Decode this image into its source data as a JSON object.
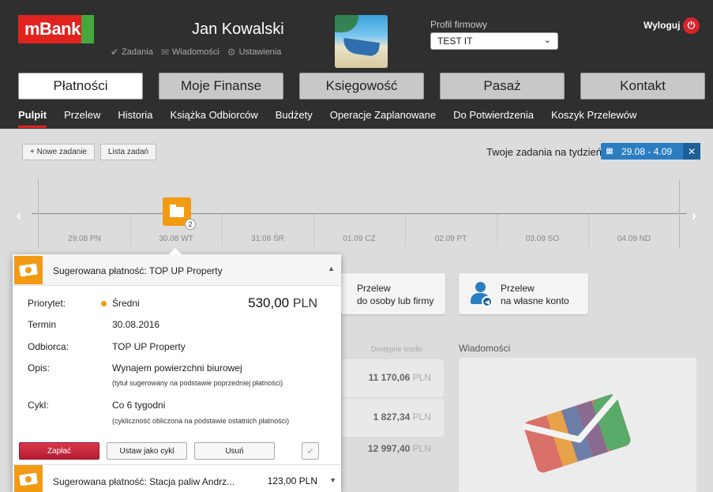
{
  "brand": {
    "logo_text": "mBank",
    "red": "#e0231f",
    "orange": "#f39a14",
    "blue": "#2b7dc2"
  },
  "user": {
    "name": "Jan Kowalski",
    "links": [
      {
        "icon": "check-icon",
        "label": "Zadania"
      },
      {
        "icon": "envelope-icon",
        "label": "Wiadomości"
      },
      {
        "icon": "gear-icon",
        "label": "Ustawienia"
      }
    ]
  },
  "profile": {
    "label": "Profil firmowy",
    "selected": "TEST IT"
  },
  "logout": {
    "label": "Wyloguj",
    "icon": "power-icon"
  },
  "main_tabs": [
    {
      "label": "Płatności",
      "active": true
    },
    {
      "label": "Moje Finanse"
    },
    {
      "label": "Księgowość"
    },
    {
      "label": "Pasaż"
    },
    {
      "label": "Kontakt"
    }
  ],
  "sub_nav": [
    {
      "label": "Pulpit",
      "active": true
    },
    {
      "label": "Przelew"
    },
    {
      "label": "Historia"
    },
    {
      "label": "Książka Odbiorców"
    },
    {
      "label": "Budżety"
    },
    {
      "label": "Operacje Zaplanowane"
    },
    {
      "label": "Do Potwierdzenia"
    },
    {
      "label": "Koszyk Przelewów"
    }
  ],
  "tasks": {
    "new_task": "+ Nowe zadanie",
    "task_list": "Lista zadań",
    "week_label": "Twoje zadania na tydzień",
    "week_range": "29.08 - 4.09",
    "days": [
      "29.08 PN",
      "30.08 WT",
      "31.08 ŚR",
      "01.09 CZ",
      "02.09 PT",
      "03.09 SO",
      "04.09 ND"
    ],
    "folder_badge": "2"
  },
  "quick_tiles": [
    {
      "line1": "Przelew",
      "line2": "do osoby lub firmy"
    },
    {
      "line1": "Przelew",
      "line2": "na własne konto"
    }
  ],
  "accounts": {
    "column_label": "Dostępne środki",
    "balances": [
      {
        "value": "11 170,06",
        "currency": "PLN"
      },
      {
        "value": "1 827,34",
        "currency": "PLN"
      },
      {
        "value": "12 997,40",
        "currency": "PLN"
      }
    ]
  },
  "news": {
    "title": "Wiadomości"
  },
  "popup": {
    "title": "Sugerowana płatność: TOP UP Property",
    "priority_label": "Priorytet:",
    "priority_value": "Średni",
    "amount": "530,00",
    "currency": "PLN",
    "term_label": "Termin",
    "term_value": "30.08.2016",
    "recipient_label": "Odbiorca:",
    "recipient_value": "TOP UP Property",
    "desc_label": "Opis:",
    "desc_value": "Wynajem powierzchni biurowej",
    "desc_note": "(tytuł sugerowany na podstawie poprzedniej płatności)",
    "cycle_label": "Cykl:",
    "cycle_value": "Co 6 tygodni",
    "cycle_note": "(cykliczność obliczona na podstawie ostatnich płatności)",
    "pay_button": "Zapłać",
    "set_cycle_button": "Ustaw jako cykl",
    "delete_button": "Usuń",
    "next_title": "Sugerowana płatność: Stacja paliw Andrz...",
    "next_amount": "123,00 PLN"
  }
}
